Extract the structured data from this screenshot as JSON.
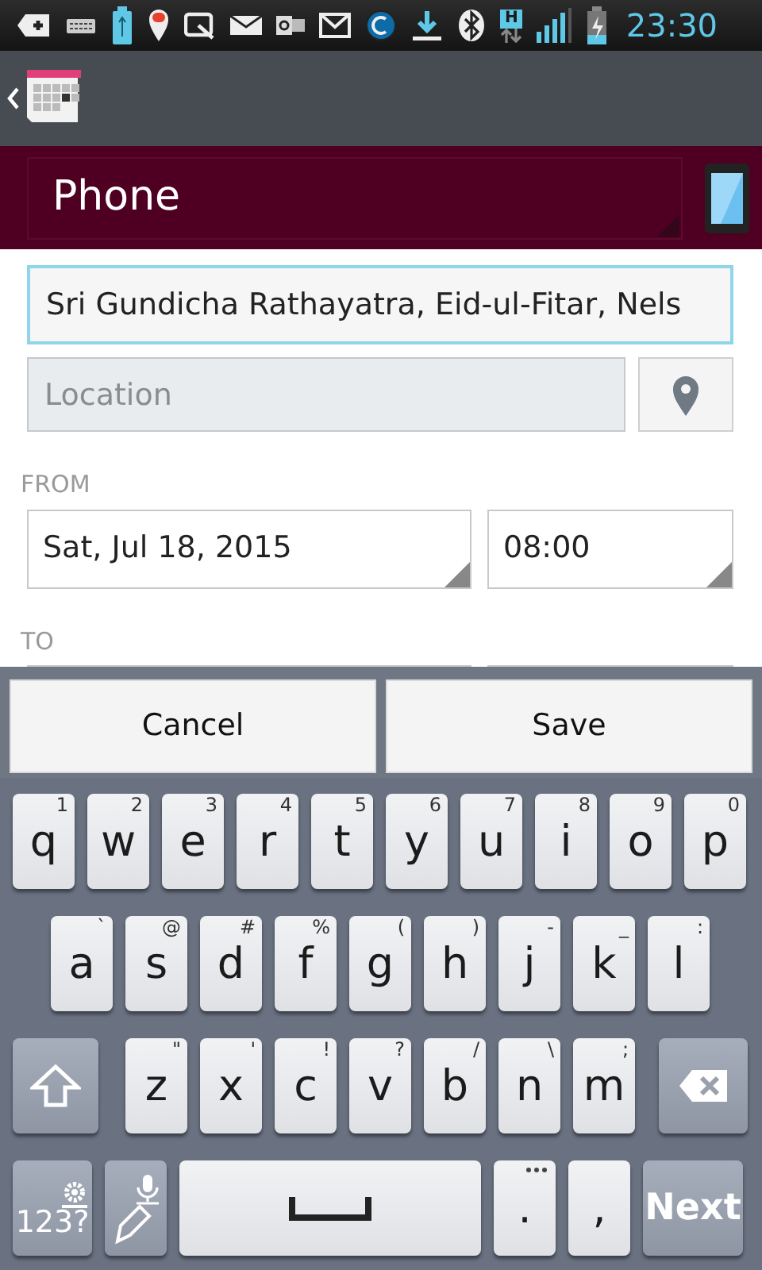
{
  "status_bar": {
    "network_type": "H",
    "time": "23:30"
  },
  "phone_bar": {
    "title": "Phone"
  },
  "form": {
    "title_value": "Sri Gundicha Rathayatra, Eid-ul-Fitar, Nels",
    "title_focused": true,
    "location_placeholder": "Location",
    "from_label": "FROM",
    "from_date": "Sat, Jul 18, 2015",
    "from_time": "08:00",
    "to_label": "TO"
  },
  "buttons": [
    "Cancel",
    "Save"
  ],
  "keyboard": {
    "rows": [
      {
        "keys": [
          {
            "kind": "letter",
            "main": "q",
            "alt": "1"
          },
          {
            "kind": "letter",
            "main": "w",
            "alt": "2"
          },
          {
            "kind": "letter",
            "main": "e",
            "alt": "3"
          },
          {
            "kind": "letter",
            "main": "r",
            "alt": "4"
          },
          {
            "kind": "letter",
            "main": "t",
            "alt": "5"
          },
          {
            "kind": "letter",
            "main": "y",
            "alt": "6"
          },
          {
            "kind": "letter",
            "main": "u",
            "alt": "7"
          },
          {
            "kind": "letter",
            "main": "i",
            "alt": "8"
          },
          {
            "kind": "letter",
            "main": "o",
            "alt": "9"
          },
          {
            "kind": "letter",
            "main": "p",
            "alt": "0"
          }
        ]
      },
      {
        "keys": [
          {
            "kind": "letter",
            "main": "a",
            "alt": "`"
          },
          {
            "kind": "letter",
            "main": "s",
            "alt": "@"
          },
          {
            "kind": "letter",
            "main": "d",
            "alt": "#"
          },
          {
            "kind": "letter",
            "main": "f",
            "alt": "%"
          },
          {
            "kind": "letter",
            "main": "g",
            "alt": "("
          },
          {
            "kind": "letter",
            "main": "h",
            "alt": ")"
          },
          {
            "kind": "letter",
            "main": "j",
            "alt": "-"
          },
          {
            "kind": "letter",
            "main": "k",
            "alt": "_"
          },
          {
            "kind": "letter",
            "main": "l",
            "alt": ":"
          }
        ]
      },
      {
        "keys": [
          {
            "kind": "shift"
          },
          {
            "kind": "letter",
            "main": "z",
            "alt": "\""
          },
          {
            "kind": "letter",
            "main": "x",
            "alt": "'"
          },
          {
            "kind": "letter",
            "main": "c",
            "alt": "!"
          },
          {
            "kind": "letter",
            "main": "v",
            "alt": "?"
          },
          {
            "kind": "letter",
            "main": "b",
            "alt": "/"
          },
          {
            "kind": "letter",
            "main": "n",
            "alt": "\\"
          },
          {
            "kind": "letter",
            "main": "m",
            "alt": ";"
          },
          {
            "kind": "backspace"
          }
        ]
      },
      {
        "keys": [
          {
            "kind": "symbols",
            "main": "123?"
          },
          {
            "kind": "voice"
          },
          {
            "kind": "space"
          },
          {
            "kind": "punct",
            "main": ".",
            "more": true
          },
          {
            "kind": "punct",
            "main": ","
          },
          {
            "kind": "next",
            "main": "Next"
          }
        ]
      }
    ]
  }
}
